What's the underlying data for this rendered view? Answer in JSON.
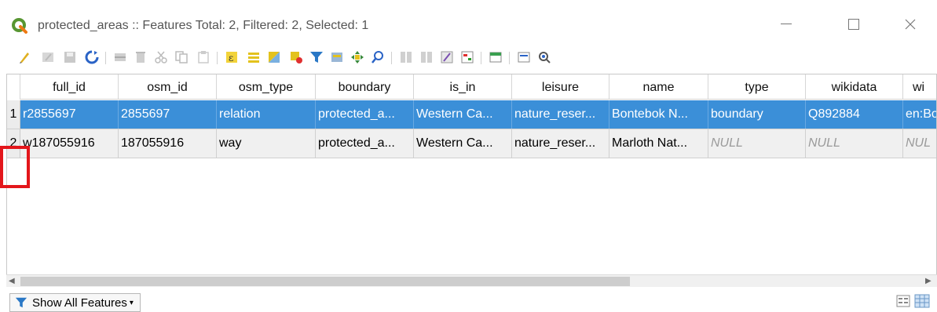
{
  "window": {
    "title": "protected_areas :: Features Total: 2, Filtered: 2, Selected: 1",
    "minimize_glyph": "—",
    "maximize_glyph": "☐",
    "close_glyph": "✕"
  },
  "toolbar": {
    "icons": [
      "toggle-editing-icon",
      "multi-edit-icon",
      "save-edits-icon",
      "reload-icon",
      "add-feature-icon",
      "delete-feature-icon",
      "cut-icon",
      "copy-icon",
      "paste-icon",
      "expression-select-icon",
      "select-all-icon",
      "invert-selection-icon",
      "deselect-all-icon",
      "filter-icon",
      "move-selection-top-icon",
      "pan-to-selected-icon",
      "zoom-to-selected-icon",
      "new-field-icon",
      "delete-field-icon",
      "open-field-calculator-icon",
      "conditional-formatting-icon",
      "dock-icon",
      "actions-icon",
      "form-view-icon",
      "identify-icon"
    ]
  },
  "table": {
    "columns": [
      "full_id",
      "osm_id",
      "osm_type",
      "boundary",
      "is_in",
      "leisure",
      "name",
      "type",
      "wikidata",
      "wi"
    ],
    "rows": [
      {
        "row_number": "1",
        "selected": true,
        "cells": [
          "r2855697",
          "2855697",
          "relation",
          "protected_a...",
          "Western Ca...",
          "nature_reser...",
          "Bontebok N...",
          "boundary",
          "Q892884",
          "en:Bo"
        ]
      },
      {
        "row_number": "2",
        "selected": false,
        "cells": [
          "w187055916",
          "187055916",
          "way",
          "protected_a...",
          "Western Ca...",
          "nature_reser...",
          "Marloth Nat...",
          "NULL",
          "NULL",
          "NUL"
        ]
      }
    ]
  },
  "scrollbar": {
    "left_arrow": "◀",
    "right_arrow": "▶"
  },
  "bottom": {
    "show_features_label": "Show All Features",
    "view_buttons": [
      "form-view-icon",
      "table-view-icon"
    ]
  },
  "colors": {
    "selection": "#3b8fd8",
    "highlight": "#e3161b",
    "qgis_green": "#589632"
  }
}
